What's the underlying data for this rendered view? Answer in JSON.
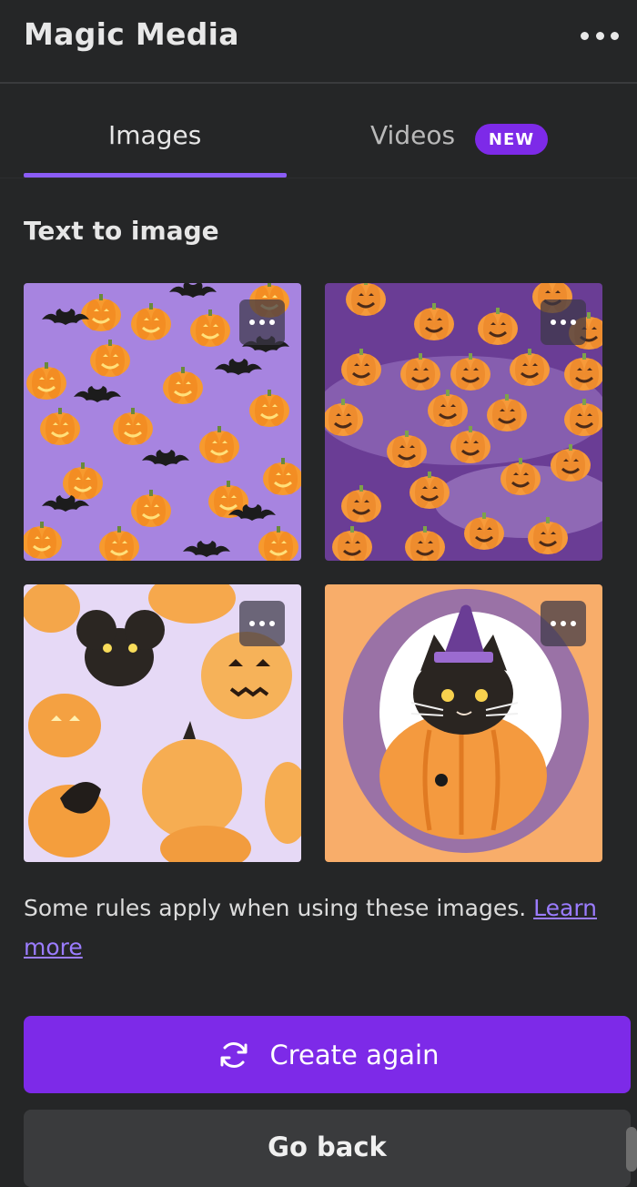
{
  "header": {
    "title": "Magic Media",
    "more_icon": "more-horizontal-icon"
  },
  "tabs": [
    {
      "label": "Images",
      "active": true
    },
    {
      "label": "Videos",
      "active": false,
      "badge": "NEW"
    }
  ],
  "section": {
    "title": "Text to image"
  },
  "results": [
    {
      "name": "halloween-pumpkins-bats-purple"
    },
    {
      "name": "halloween-pumpkins-dark-purple"
    },
    {
      "name": "halloween-pumpkins-black-cat"
    },
    {
      "name": "halloween-witch-cat-pumpkin"
    }
  ],
  "notice": {
    "text": "Some rules apply when using these images. ",
    "link": "Learn more"
  },
  "actions": {
    "create_again": "Create again",
    "create_icon": "refresh-icon",
    "go_back": "Go back"
  },
  "colors": {
    "accent": "#7d2ae8",
    "underline": "#8b5cf6",
    "link": "#9b7cff",
    "background": "#252627"
  }
}
